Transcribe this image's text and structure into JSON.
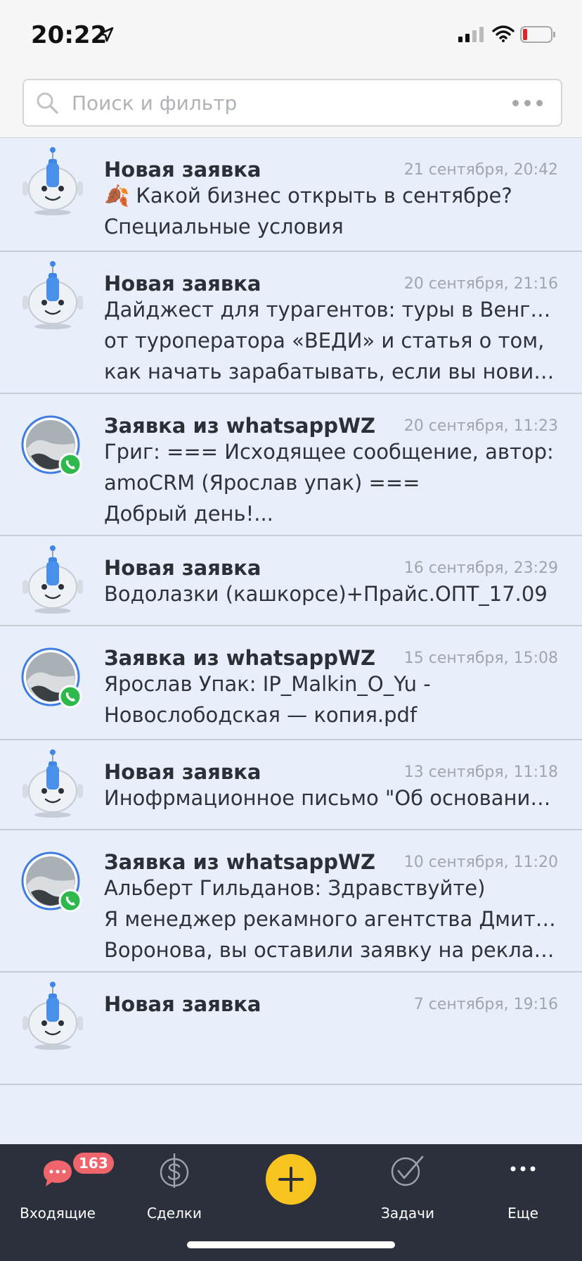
{
  "status_bar": {
    "time": "20:22"
  },
  "search": {
    "placeholder": "Поиск и фильтр"
  },
  "items": [
    {
      "avatar": "robot",
      "title": "Новая заявка",
      "date": "21 сентября, 20:42",
      "lines": [
        "🍂 Какой бизнес открыть в сентябре?",
        "Специальные условия"
      ]
    },
    {
      "avatar": "robot",
      "title": "Новая заявка",
      "date": "20 сентября, 21:16",
      "lines": [
        "Дайджест для турагентов: туры в Венгрию",
        "от туроператора «ВЕДИ» и статья о том,",
        "как начать зарабатывать, если вы новичо..."
      ]
    },
    {
      "avatar": "whatsapp",
      "title": "Заявка из whatsappWZ",
      "date": "20 сентября, 11:23",
      "lines": [
        "Григ: === Исходящее сообщение, автор:",
        "amoCRM (Ярослав упак) ===",
        "Добрый день!..."
      ]
    },
    {
      "avatar": "robot",
      "title": "Новая заявка",
      "date": "16 сентября, 23:29",
      "lines": [
        "Водолазки (кашкорсе)+Прайс.ОПТ_17.09"
      ]
    },
    {
      "avatar": "whatsapp",
      "title": "Заявка из whatsappWZ",
      "date": "15 сентября, 15:08",
      "lines": [
        "Ярослав Упак: IP_Malkin_O_Yu -",
        "Новослободская — копия.pdf"
      ]
    },
    {
      "avatar": "robot",
      "title": "Новая заявка",
      "date": "13 сентября, 11:18",
      "lines": [
        "Инофрмационное письмо \"Об основаниях\""
      ]
    },
    {
      "avatar": "whatsapp",
      "title": "Заявка из whatsappWZ",
      "date": "10 сентября, 11:20",
      "lines": [
        "Альберт Гильданов: Здравствуйте)",
        "Я менеджер рекамного агентства Дмитрия",
        "Воронова, вы оставили заявку на реклам..."
      ]
    },
    {
      "avatar": "robot",
      "title": "Новая заявка",
      "date": "7 сентября, 19:16",
      "lines": []
    }
  ],
  "tabbar": {
    "inbox": {
      "label": "Входящие",
      "badge": "163",
      "icon": "chat-bubble-icon"
    },
    "deals": {
      "label": "Сделки",
      "icon": "dollar-icon"
    },
    "add": {
      "icon": "plus-icon",
      "color": "#f7c41f"
    },
    "tasks": {
      "label": "Задачи",
      "icon": "check-circle-icon"
    },
    "more": {
      "label": "Еще",
      "icon": "more-dots-icon"
    }
  },
  "colors": {
    "list_bg": "#e8effb",
    "tabbar_bg": "#2b303c",
    "badge": "#f0646c",
    "whatsapp": "#2fb94d",
    "avatar_ring": "#3f7de0"
  }
}
